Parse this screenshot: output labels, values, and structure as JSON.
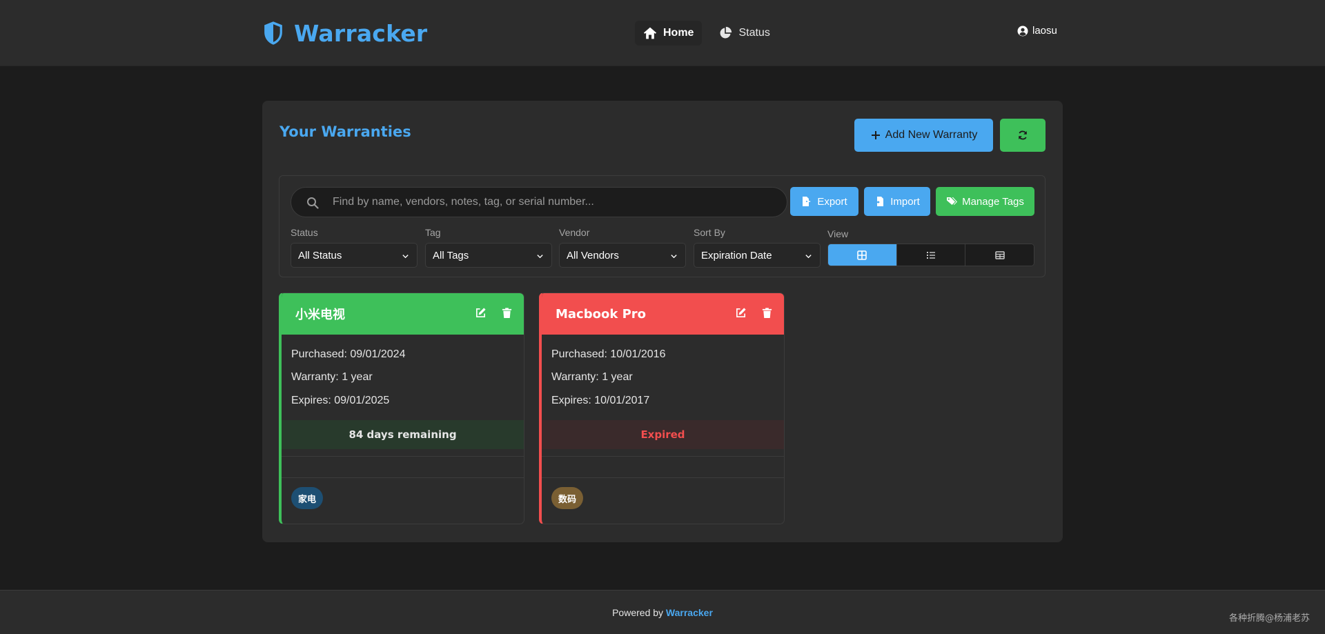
{
  "header": {
    "brand": "Warracker",
    "nav": [
      {
        "label": "Home",
        "icon": "home-icon"
      },
      {
        "label": "Status",
        "icon": "pie-chart-icon"
      }
    ],
    "user": "laosu"
  },
  "main": {
    "title": "Your Warranties",
    "add_button": "Add New Warranty",
    "search_placeholder": "Find by name, vendors, notes, tag, or serial number...",
    "export_label": "Export",
    "import_label": "Import",
    "manage_tags_label": "Manage Tags",
    "filters": {
      "status": {
        "label": "Status",
        "value": "All Status"
      },
      "tag": {
        "label": "Tag",
        "value": "All Tags"
      },
      "vendor": {
        "label": "Vendor",
        "value": "All Vendors"
      },
      "sort": {
        "label": "Sort By",
        "value": "Expiration Date"
      }
    },
    "view_label": "View"
  },
  "cards": [
    {
      "title": "小米电视",
      "purchased": "Purchased: 09/01/2024",
      "warranty": "Warranty: 1 year",
      "expires": "Expires: 09/01/2025",
      "status": "84 days remaining",
      "tag": "家电"
    },
    {
      "title": "Macbook Pro",
      "purchased": "Purchased: 10/01/2016",
      "warranty": "Warranty: 1 year",
      "expires": "Expires: 10/01/2017",
      "status": "Expired",
      "tag": "数码"
    }
  ],
  "footer": {
    "prefix": "Powered by",
    "link": "Warracker",
    "watermark": "各种折腾@杨浦老苏"
  },
  "colors": {
    "accent_blue": "#4aa8f0",
    "accent_green": "#3ec05a",
    "accent_red": "#f24e4e",
    "background": "#1c1c1c",
    "surface": "#2c2c2c"
  }
}
